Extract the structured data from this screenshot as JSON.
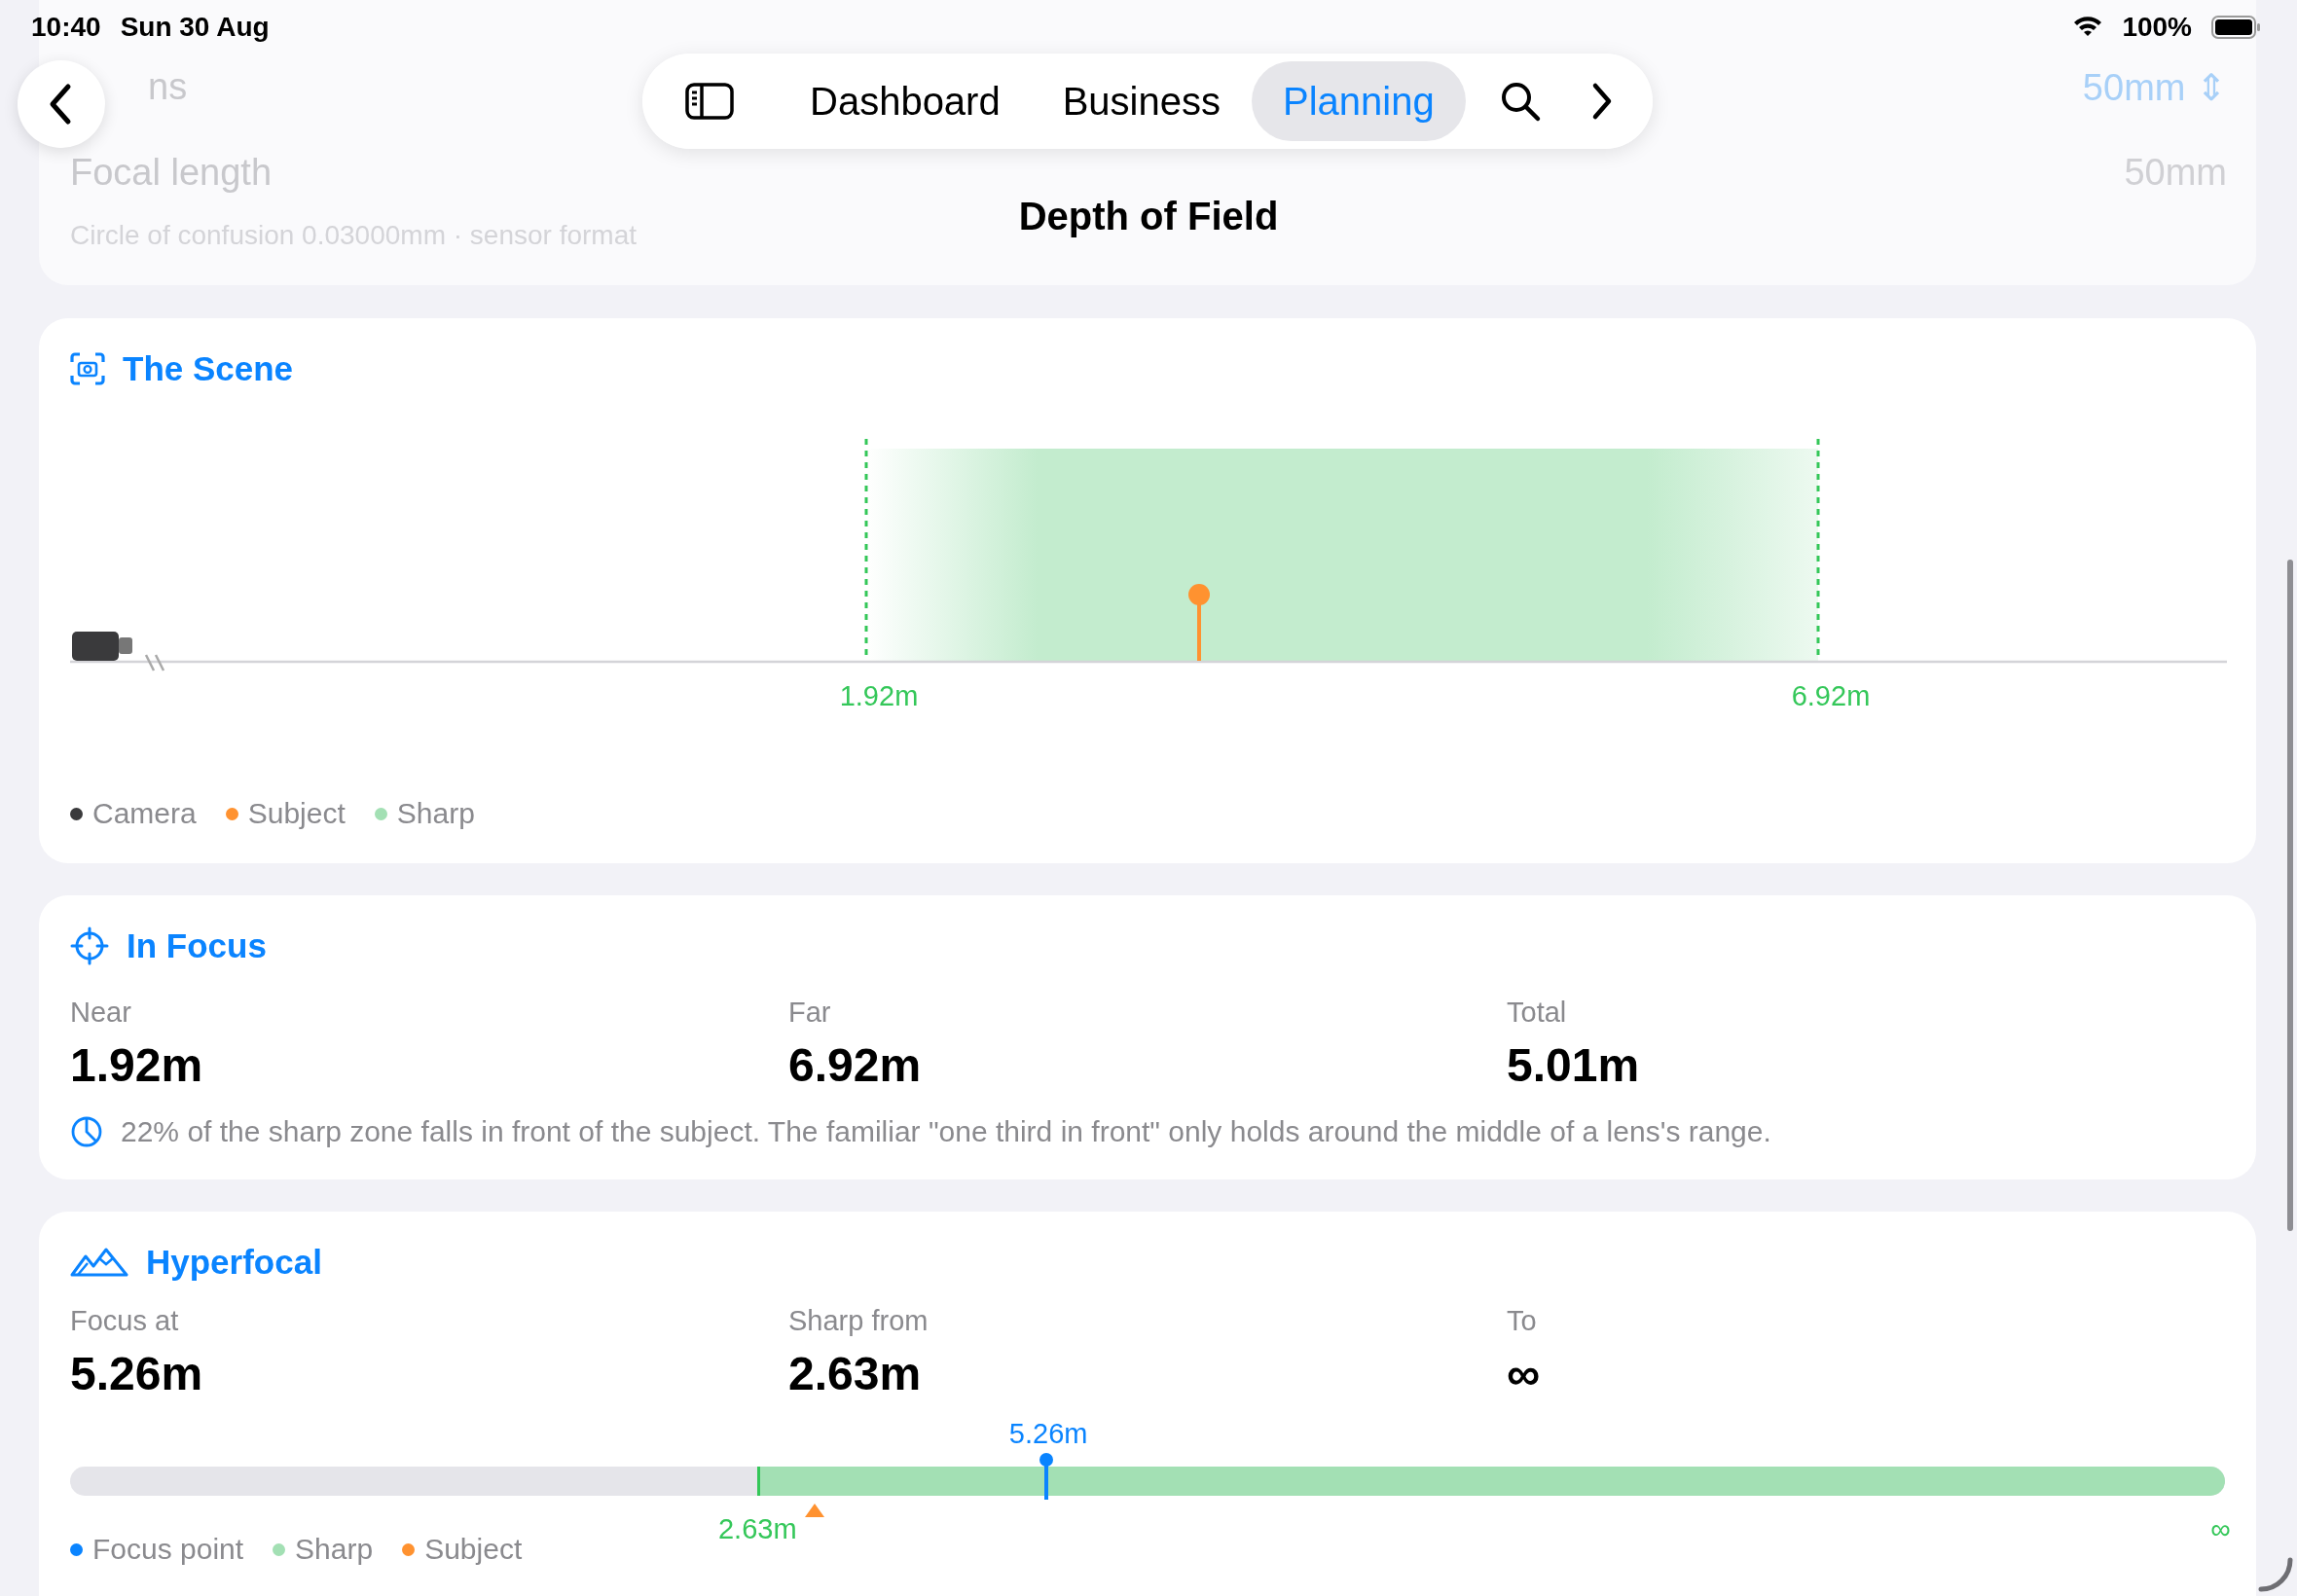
{
  "status_bar": {
    "time": "10:40",
    "date": "Sun 30 Aug",
    "battery": "100%"
  },
  "background_card": {
    "row_1_label": "ns",
    "row_1_value": "50mm ⇕",
    "row_2_label": "Focal length",
    "row_2_value": "50mm",
    "note": "Circle of confusion 0.03000mm · sensor format"
  },
  "nav": {
    "tabs": [
      {
        "label": "Dashboard",
        "selected": false
      },
      {
        "label": "Business",
        "selected": false
      },
      {
        "label": "Planning",
        "selected": true
      }
    ]
  },
  "title": "Depth of Field",
  "scene": {
    "heading": "The Scene",
    "near_label": "1.92m",
    "far_label": "6.92m",
    "legend": [
      {
        "label": "Camera",
        "color": "#3a3a3c"
      },
      {
        "label": "Subject",
        "color": "#ff9230"
      },
      {
        "label": "Sharp",
        "color": "#a3e0b4"
      }
    ]
  },
  "in_focus": {
    "heading": "In Focus",
    "stats": [
      {
        "label": "Near",
        "value": "1.92m"
      },
      {
        "label": "Far",
        "value": "6.92m"
      },
      {
        "label": "Total",
        "value": "5.01m"
      }
    ],
    "note": "22% of the sharp zone falls in front of the subject. The familiar \"one third in front\" only holds around the middle of a lens's range."
  },
  "hyperfocal": {
    "heading": "Hyperfocal",
    "stats": [
      {
        "label": "Focus at",
        "value": "5.26m"
      },
      {
        "label": "Sharp from",
        "value": "2.63m"
      },
      {
        "label": "To",
        "value": "∞"
      }
    ],
    "focus_label": "5.26m",
    "sharp_from_label": "2.63m",
    "end_label": "∞",
    "legend": [
      {
        "label": "Focus point",
        "color": "#0a84ff"
      },
      {
        "label": "Sharp",
        "color": "#a3e0b4"
      },
      {
        "label": "Subject",
        "color": "#ff9230"
      }
    ]
  }
}
